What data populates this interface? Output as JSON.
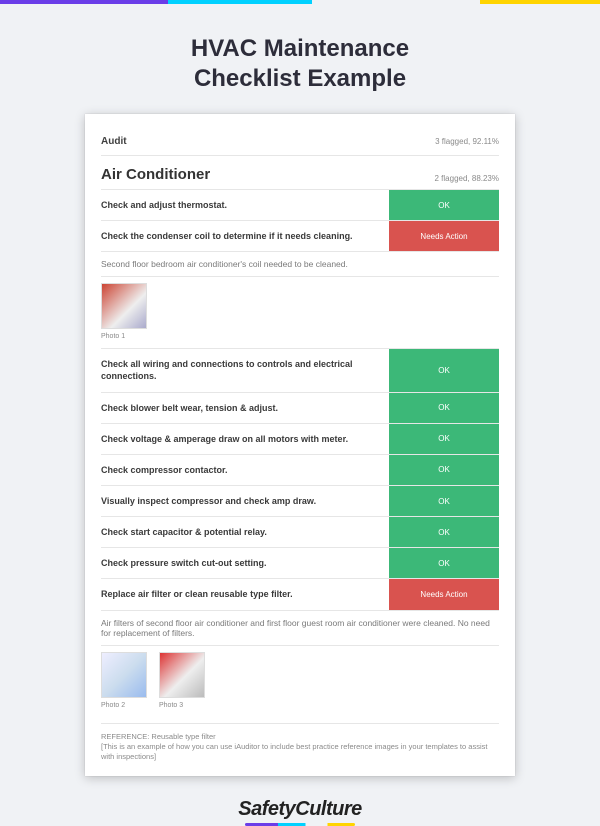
{
  "page_title_line1": "HVAC Maintenance",
  "page_title_line2": "Checklist Example",
  "audit": {
    "label": "Audit",
    "meta": "3 flagged, 92.11%"
  },
  "section": {
    "title": "Air Conditioner",
    "meta": "2 flagged, 88.23%"
  },
  "items": [
    {
      "label": "Check and adjust thermostat.",
      "status": "OK",
      "status_type": "ok"
    },
    {
      "label": "Check the condenser coil to determine if it needs cleaning.",
      "status": "Needs Action",
      "status_type": "needs"
    }
  ],
  "note1": "Second floor bedroom air conditioner's coil needed to be cleaned.",
  "photos1": [
    {
      "caption": "Photo 1"
    }
  ],
  "items2": [
    {
      "label": "Check all wiring and connections to controls and electrical connections.",
      "status": "OK",
      "status_type": "ok"
    },
    {
      "label": "Check blower belt wear, tension & adjust.",
      "status": "OK",
      "status_type": "ok"
    },
    {
      "label": "Check voltage & amperage draw on all motors with meter.",
      "status": "OK",
      "status_type": "ok"
    },
    {
      "label": "Check compressor contactor.",
      "status": "OK",
      "status_type": "ok"
    },
    {
      "label": "Visually inspect compressor and check amp draw.",
      "status": "OK",
      "status_type": "ok"
    },
    {
      "label": "Check start capacitor & potential relay.",
      "status": "OK",
      "status_type": "ok"
    },
    {
      "label": "Check pressure switch cut-out setting.",
      "status": "OK",
      "status_type": "ok"
    },
    {
      "label": "Replace air filter or clean reusable type filter.",
      "status": "Needs Action",
      "status_type": "needs"
    }
  ],
  "note2": "Air filters of second floor air conditioner and first floor guest room air conditioner were cleaned. No need for replacement of filters.",
  "photos2": [
    {
      "caption": "Photo 2"
    },
    {
      "caption": "Photo 3"
    }
  ],
  "reference_title": "REFERENCE: Reusable type filter",
  "reference_body": "[This is an example of how you can use iAuditor to include best practice reference images in your templates to assist with inspections]",
  "footer_brand": "SafetyCulture"
}
